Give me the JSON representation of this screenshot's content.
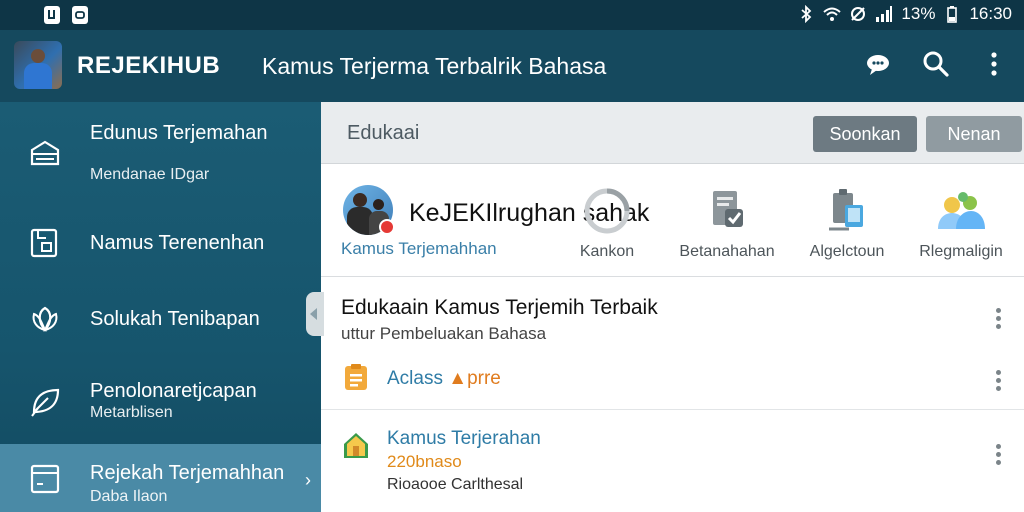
{
  "status_bar": {
    "battery": "13%",
    "time": "16:30"
  },
  "app_bar": {
    "brand": "REJEKIHUB",
    "title": "Kamus Terjerma Terbalrik Bahasa"
  },
  "drawer": {
    "items": [
      {
        "label": "Edunus Terjemahan",
        "sub": "Mendanae IDgar",
        "icon": "inbox-icon"
      },
      {
        "label": "Namus Terenenhan",
        "sub": "",
        "icon": "document-icon"
      },
      {
        "label": "Solukah Tenibapan",
        "sub": "",
        "icon": "lotus-icon"
      },
      {
        "label": "Penolonaretjcapan",
        "sub": "Metarblisen",
        "icon": "leaf-icon"
      },
      {
        "label": "Rejekah Terjemahhan",
        "sub": "Daba Ilaon",
        "icon": "window-icon"
      }
    ]
  },
  "subbar": {
    "title": "Edukaai",
    "button_primary": "Soonkan",
    "button_secondary": "Nenan"
  },
  "categories": {
    "heading": "KeJEKIlrughan sahak",
    "subtitle": "Kamus Terjemahhan",
    "items": [
      {
        "label": "Kankon",
        "icon": "loading-ring-icon"
      },
      {
        "label": "Betanahahan",
        "icon": "document-check-icon"
      },
      {
        "label": "Algelctoun",
        "icon": "clipboard-tablet-icon"
      },
      {
        "label": "Rlegmaligin",
        "icon": "people-group-icon"
      }
    ]
  },
  "list": {
    "heading": "Edukaain Kamus Terjemih Terbaik",
    "subheading": "uttur Pembeluakan Bahasa",
    "rows": [
      {
        "title": "Aclass",
        "accent": "prre",
        "number": "",
        "subtitle": "",
        "icon": "clipboard-list-icon"
      },
      {
        "title": "Kamus Terjerahan",
        "accent": "",
        "number": "220bnaso",
        "subtitle": "Rioaooe Carlthesal",
        "icon": "house-icon"
      }
    ]
  },
  "colors": {
    "statusbar": "#0e3546",
    "appbar": "#15495e",
    "drawer": "#1b5c74",
    "drawer_active": "#4a8aa6",
    "link": "#2f7ca6",
    "accent_orange": "#e08a1a",
    "button_dark": "#6d7a82",
    "button_light": "#909ba1"
  }
}
